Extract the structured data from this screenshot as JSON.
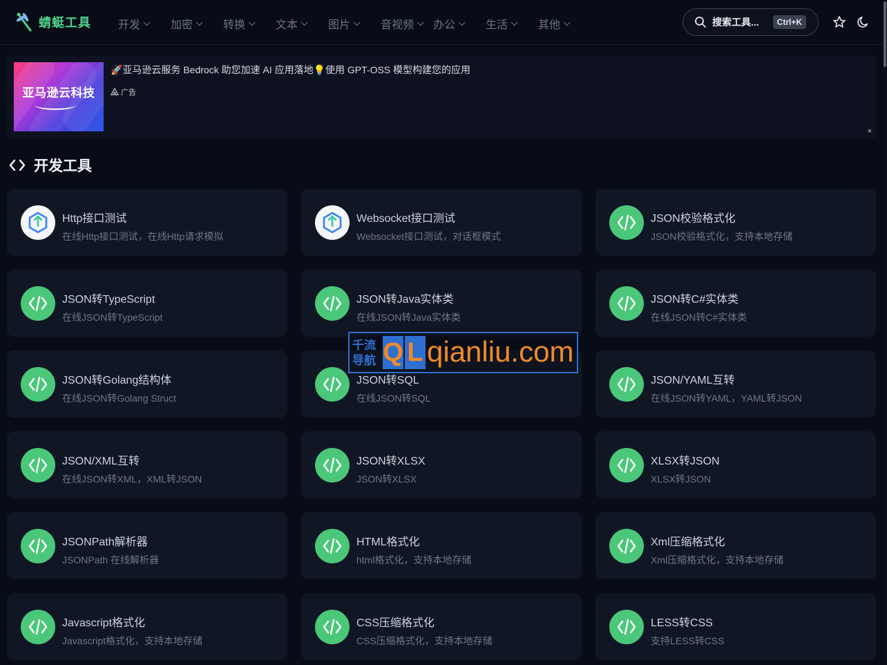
{
  "header": {
    "brand": "蜻蜓工具",
    "nav": [
      "开发",
      "加密",
      "转换",
      "文本",
      "图片",
      "音视频",
      "办公",
      "生活",
      "其他"
    ],
    "search_placeholder": "搜索工具...",
    "search_shortcut": "Ctrl+K"
  },
  "ad": {
    "image_text": "亚马逊云科技",
    "title": "🚀亚马逊云服务 Bedrock 助您加速 AI 应用落地💡使用 GPT-OSS 模型构建您的应用",
    "tag": "广告",
    "close": "×"
  },
  "section": {
    "title": "开发工具"
  },
  "tools": [
    {
      "title": "Http接口测试",
      "desc": "在线Http接口测试，在线Http请求模拟",
      "icon": "http-upload-icon"
    },
    {
      "title": "Websocket接口测试",
      "desc": "Websocket接口测试，对话框模式",
      "icon": "http-upload-icon"
    },
    {
      "title": "JSON校验格式化",
      "desc": "JSON校验格式化，支持本地存储",
      "icon": "code-icon"
    },
    {
      "title": "JSON转TypeScript",
      "desc": "在线JSON转TypeScript",
      "icon": "code-icon"
    },
    {
      "title": "JSON转Java实体类",
      "desc": "在线JSON转Java实体类",
      "icon": "code-icon"
    },
    {
      "title": "JSON转C#实体类",
      "desc": "在线JSON转C#实体类",
      "icon": "code-icon"
    },
    {
      "title": "JSON转Golang结构体",
      "desc": "在线JSON转Golang Struct",
      "icon": "code-icon"
    },
    {
      "title": "JSON转SQL",
      "desc": "在线JSON转SQL",
      "icon": "code-icon"
    },
    {
      "title": "JSON/YAML互转",
      "desc": "在线JSON转YAML，YAML转JSON",
      "icon": "code-icon"
    },
    {
      "title": "JSON/XML互转",
      "desc": "在线JSON转XML，XML转JSON",
      "icon": "code-icon"
    },
    {
      "title": "JSON转XLSX",
      "desc": "JSON转XLSX",
      "icon": "code-icon"
    },
    {
      "title": "XLSX转JSON",
      "desc": "XLSX转JSON",
      "icon": "code-icon"
    },
    {
      "title": "JSONPath解析器",
      "desc": "JSONPath 在线解析器",
      "icon": "code-icon"
    },
    {
      "title": "HTML格式化",
      "desc": "html格式化，支持本地存储",
      "icon": "code-icon"
    },
    {
      "title": "Xml压缩格式化",
      "desc": "Xml压缩格式化，支持本地存储",
      "icon": "code-icon"
    },
    {
      "title": "Javascript格式化",
      "desc": "Javascript格式化，支持本地存储",
      "icon": "code-icon"
    },
    {
      "title": "CSS压缩格式化",
      "desc": "CSS压缩格式化，支持本地存储",
      "icon": "code-icon"
    },
    {
      "title": "LESS转CSS",
      "desc": "支持LESS转CSS",
      "icon": "code-icon"
    }
  ],
  "watermark": {
    "cn": "千流导航",
    "letters": [
      "Q",
      "L"
    ],
    "domain": "qianliu.com"
  },
  "colors": {
    "background": "#080c16",
    "card": "#111624",
    "accent_green": "#4bc77a",
    "brand_green": "#4fd08c",
    "watermark_blue": "#2f6fd0",
    "watermark_orange": "#f08a28"
  }
}
